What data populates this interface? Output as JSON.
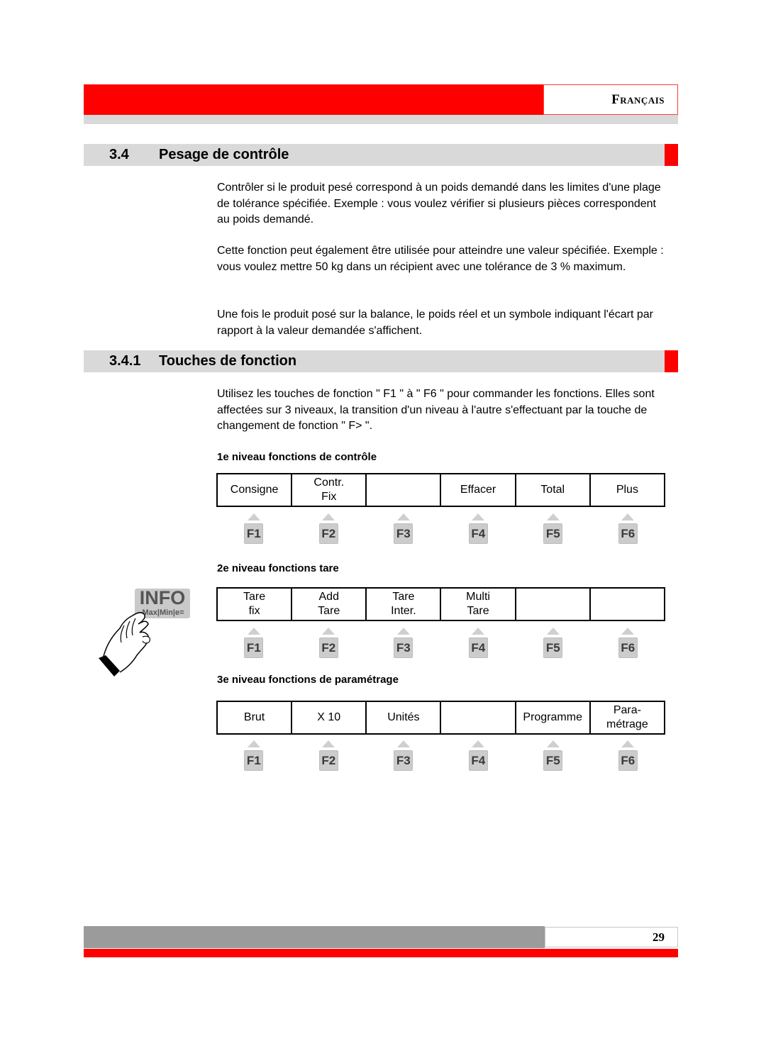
{
  "header": {
    "language": "Français"
  },
  "sections": [
    {
      "number": "3.4",
      "title": "Pesage de contrôle",
      "paragraphs": [
        "Contrôler si le produit pesé correspond à un poids demandé dans les limites d'une plage de tolérance spécifiée. Exemple : vous voulez vérifier si plusieurs pièces correspondent au poids demandé.",
        "Cette fonction peut également être utilisée pour atteindre une valeur spécifiée. Exemple : vous voulez mettre 50 kg dans un récipient avec une tolérance de 3 % maximum.",
        "Une fois le produit posé sur la balance, le poids réel et un symbole indiquant l'écart par rapport à la valeur demandée s'affichent."
      ]
    },
    {
      "number": "3.4.1",
      "title": "Touches de fonction",
      "paragraphs": [
        "Utilisez les touches de fonction \" F1 \" à \" F6 \" pour commander les fonctions. Elles sont affectées sur 3 niveaux, la transition d'un niveau à l'autre s'effectuant par la touche de changement de fonction \" F> \"."
      ]
    }
  ],
  "levels": [
    {
      "title": "1e niveau fonctions de contrôle",
      "cells": [
        [
          "Consigne"
        ],
        [
          "Contr.",
          "Fix"
        ],
        [],
        [
          "Effacer"
        ],
        [
          "Total"
        ],
        [
          "Plus"
        ]
      ]
    },
    {
      "title": "2e niveau fonctions tare",
      "cells": [
        [
          "Tare",
          "fix"
        ],
        [
          "Add",
          "Tare"
        ],
        [
          "Tare",
          "Inter."
        ],
        [
          "Multi",
          "Tare"
        ],
        [],
        []
      ]
    },
    {
      "title": "3e niveau fonctions de paramétrage",
      "cells": [
        [
          "Brut"
        ],
        [
          "X 10"
        ],
        [
          "Unités"
        ],
        [],
        [
          "Programme"
        ],
        [
          "Para-",
          "métrage"
        ]
      ]
    }
  ],
  "function_keys": [
    "F1",
    "F2",
    "F3",
    "F4",
    "F5",
    "F6"
  ],
  "info_key": {
    "label": "INFO",
    "sublabel": "Max|Min|e="
  },
  "footer": {
    "page_number": "29"
  },
  "colors": {
    "accent": "#ff0000",
    "bar_gray": "#d9d9d9",
    "footer_gray": "#9b9b9b"
  }
}
